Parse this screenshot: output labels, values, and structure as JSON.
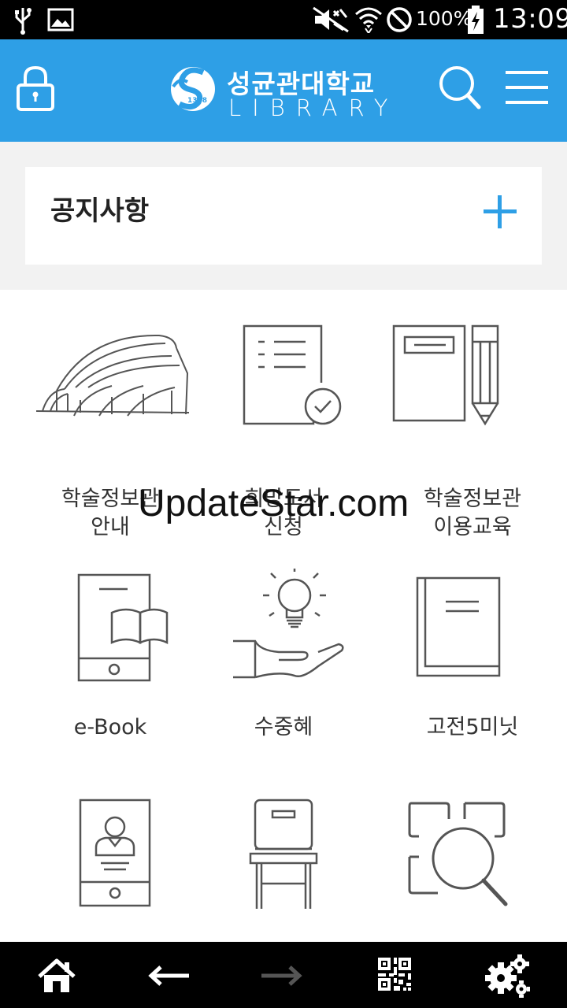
{
  "status_bar": {
    "battery_text": "100%",
    "time": "13:09"
  },
  "header": {
    "logo_korean": "성균관대학교",
    "logo_english": "LIBRARY",
    "logo_year": "1398",
    "brand_color": "#2e9fe6"
  },
  "notice": {
    "title": "공지사항"
  },
  "menu": {
    "items": [
      {
        "label_line1": "학술정보관",
        "label_line2": "안내",
        "icon": "building-icon"
      },
      {
        "label_line1": "희망도서",
        "label_line2": "신청",
        "icon": "document-check-icon"
      },
      {
        "label_line1": "학술정보관",
        "label_line2": "이용교육",
        "icon": "notebook-pencil-icon"
      },
      {
        "label_line1": "e-Book",
        "label_line2": "",
        "icon": "tablet-book-icon"
      },
      {
        "label_line1": "수중혜",
        "label_line2": "",
        "icon": "lightbulb-hand-icon"
      },
      {
        "label_line1": "고전5미닛",
        "label_line2": "",
        "icon": "book-icon"
      },
      {
        "label_line1": "",
        "label_line2": "",
        "icon": "mobile-id-icon"
      },
      {
        "label_line1": "",
        "label_line2": "",
        "icon": "chair-icon"
      },
      {
        "label_line1": "",
        "label_line2": "",
        "icon": "search-grid-icon"
      }
    ]
  },
  "watermark": {
    "text": "UpdateStar.com"
  }
}
